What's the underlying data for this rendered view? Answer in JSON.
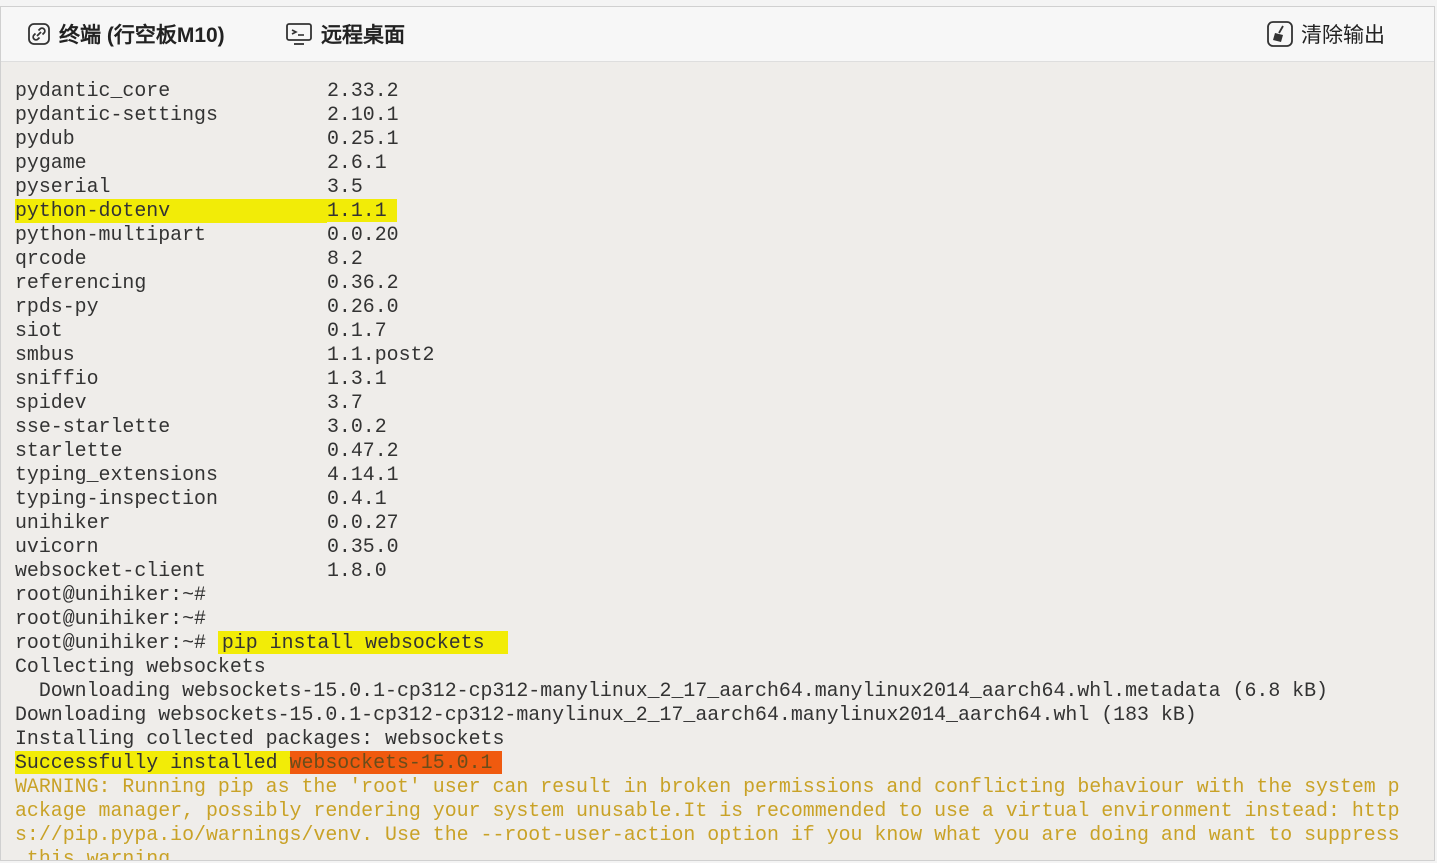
{
  "toolbar": {
    "terminal_label": "终端 (行空板M10)",
    "remote_label": "远程桌面",
    "clear_label": "清除输出"
  },
  "packages": [
    {
      "name": "pydantic_core",
      "version": "2.33.2"
    },
    {
      "name": "pydantic-settings",
      "version": "2.10.1"
    },
    {
      "name": "pydub",
      "version": "0.25.1"
    },
    {
      "name": "pygame",
      "version": "2.6.1"
    },
    {
      "name": "pyserial",
      "version": "3.5"
    },
    {
      "name": "python-dotenv",
      "version": "1.1.1"
    },
    {
      "name": "python-multipart",
      "version": "0.0.20"
    },
    {
      "name": "qrcode",
      "version": "8.2"
    },
    {
      "name": "referencing",
      "version": "0.36.2"
    },
    {
      "name": "rpds-py",
      "version": "0.26.0"
    },
    {
      "name": "siot",
      "version": "0.1.7"
    },
    {
      "name": "smbus",
      "version": "1.1.post2"
    },
    {
      "name": "sniffio",
      "version": "1.3.1"
    },
    {
      "name": "spidev",
      "version": "3.7"
    },
    {
      "name": "sse-starlette",
      "version": "3.0.2"
    },
    {
      "name": "starlette",
      "version": "0.47.2"
    },
    {
      "name": "typing_extensions",
      "version": "4.14.1"
    },
    {
      "name": "typing-inspection",
      "version": "0.4.1"
    },
    {
      "name": "unihiker",
      "version": "0.0.27"
    },
    {
      "name": "uvicorn",
      "version": "0.35.0"
    },
    {
      "name": "websocket-client",
      "version": "1.8.0"
    }
  ],
  "prompt": "root@unihiker:~# ",
  "command": "pip install websockets",
  "output": {
    "collecting": "Collecting websockets",
    "downloading_meta": "  Downloading websockets-15.0.1-cp312-cp312-manylinux_2_17_aarch64.manylinux2014_aarch64.whl.metadata (6.8 kB)",
    "downloading_whl": "Downloading websockets-15.0.1-cp312-cp312-manylinux_2_17_aarch64.manylinux2014_aarch64.whl (183 kB)",
    "installing": "Installing collected packages: websockets",
    "success_prefix": "Successfully installed ",
    "success_pkg": "websockets-15.0.1",
    "warning_1": "WARNING: Running pip as the 'root' user can result in broken permissions and conflicting behaviour with the system p",
    "warning_2": "ackage manager, possibly rendering your system unusable.It is recommended to use a virtual environment instead: http",
    "warning_3": "s://pip.pypa.io/warnings/venv. Use the --root-user-action option if you know what you are doing and want to suppress",
    "warning_4": " this warning."
  },
  "highlight_color": "#f2ec07",
  "highlight_alt_color": "#f05a0f",
  "warning_color": "#c9a227"
}
